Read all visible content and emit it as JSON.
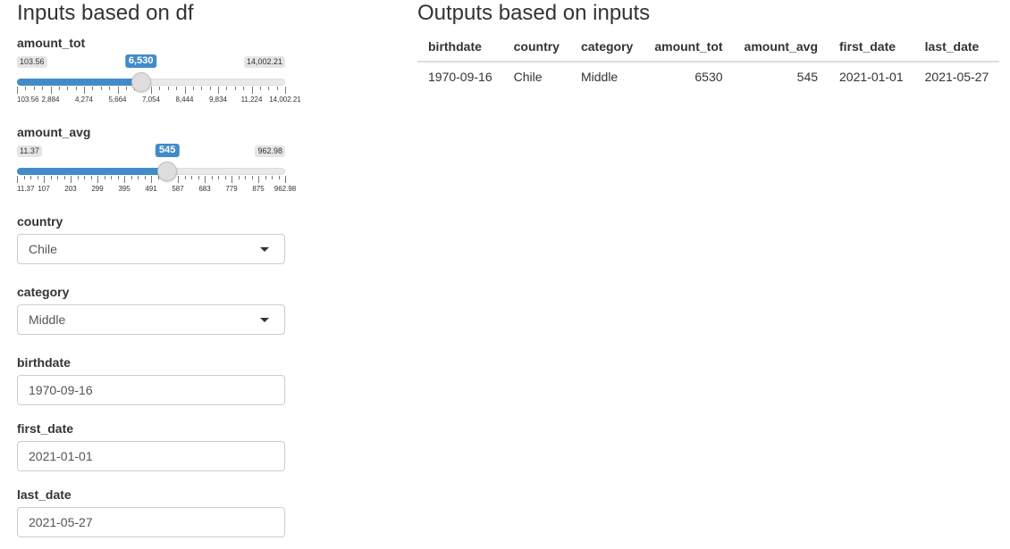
{
  "left_title": "Inputs based on df",
  "right_title": "Outputs based on inputs",
  "amount_tot": {
    "label": "amount_tot",
    "min": "103.56",
    "max": "14,002.21",
    "value": "6,530",
    "fraction": 0.4623,
    "ticks": [
      "103.56",
      "2,884",
      "4,274",
      "5,664",
      "7,054",
      "8,444",
      "9,834",
      "11,224",
      "14,002.21"
    ]
  },
  "amount_avg": {
    "label": "amount_avg",
    "min": "11.37",
    "max": "962.98",
    "value": "545",
    "fraction": 0.5608,
    "ticks": [
      "11.37",
      "107",
      "203",
      "299",
      "395",
      "491",
      "587",
      "683",
      "779",
      "875",
      "962.98"
    ]
  },
  "country": {
    "label": "country",
    "value": "Chile"
  },
  "category": {
    "label": "category",
    "value": "Middle"
  },
  "birthdate": {
    "label": "birthdate",
    "value": "1970-09-16"
  },
  "first_date": {
    "label": "first_date",
    "value": "2021-01-01"
  },
  "last_date": {
    "label": "last_date",
    "value": "2021-05-27"
  },
  "table": {
    "headers": [
      "birthdate",
      "country",
      "category",
      "amount_tot",
      "amount_avg",
      "first_date",
      "last_date"
    ],
    "rows": [
      [
        "1970-09-16",
        "Chile",
        "Middle",
        "6530",
        "545",
        "2021-01-01",
        "2021-05-27"
      ]
    ]
  },
  "colors": {
    "accent": "#428bca",
    "track": "#e9e9e9",
    "border": "#cccccc"
  }
}
